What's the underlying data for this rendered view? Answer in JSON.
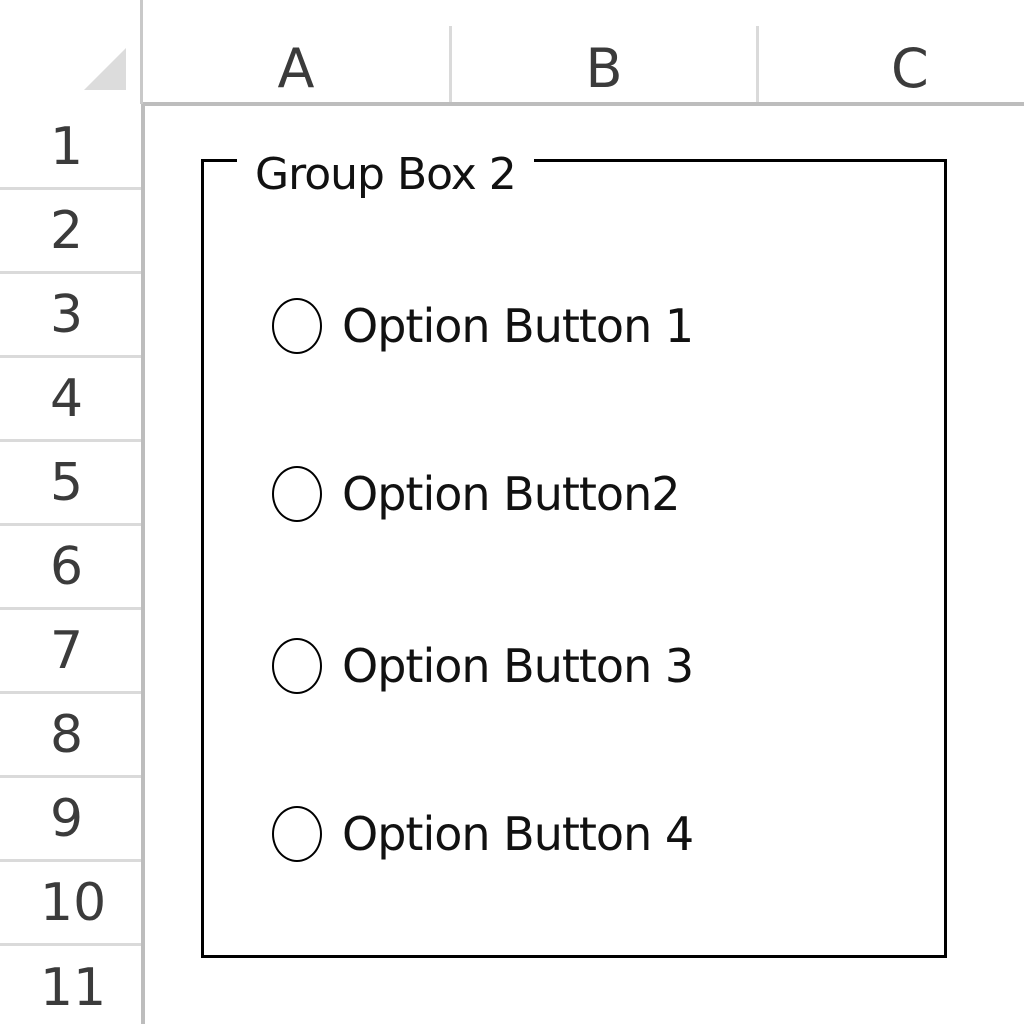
{
  "columns": [
    "A",
    "B",
    "C"
  ],
  "rows": [
    "1",
    "2",
    "3",
    "4",
    "5",
    "6",
    "7",
    "8",
    "9",
    "10",
    "11"
  ],
  "group_box": {
    "label": "Group Box 2",
    "options": [
      {
        "label": "Option Button 1",
        "selected": false
      },
      {
        "label": "Option Button2",
        "selected": false
      },
      {
        "label": "Option Button 3",
        "selected": false
      },
      {
        "label": "Option Button 4",
        "selected": false
      }
    ]
  },
  "icons": {
    "select_all": "select-all-triangle-icon"
  }
}
